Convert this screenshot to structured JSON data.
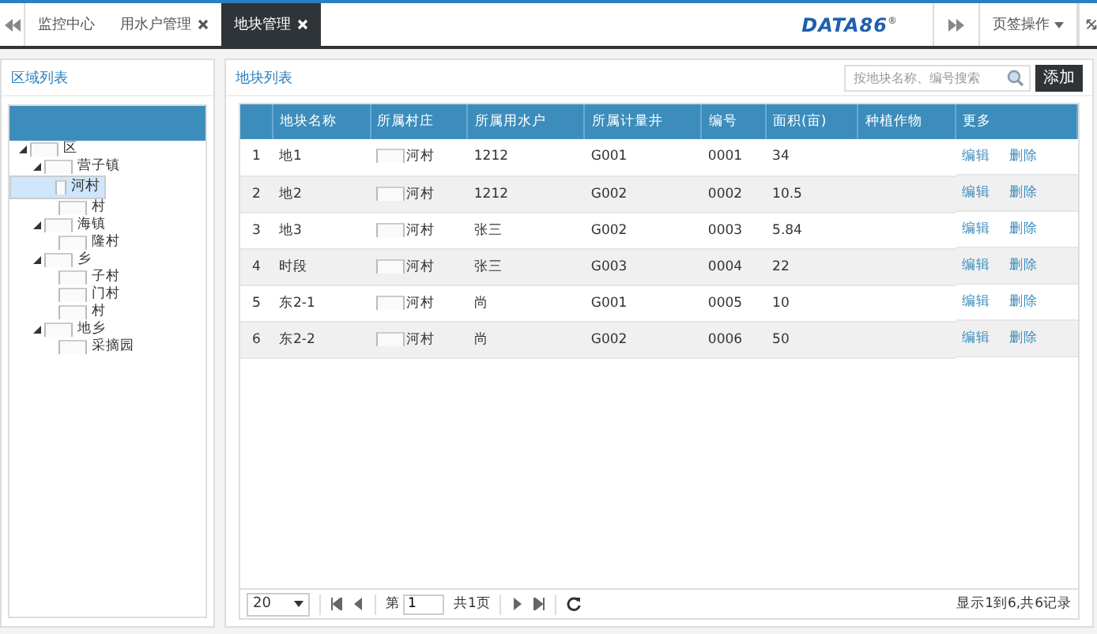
{
  "tabs": [
    {
      "label": "监控中心",
      "closable": false,
      "selected": false
    },
    {
      "label": "用水户管理",
      "closable": true,
      "selected": false
    },
    {
      "label": "地块管理",
      "closable": true,
      "selected": true
    }
  ],
  "logo": {
    "text": "DATA86",
    "mark": "®"
  },
  "tab_menu": "页签操作",
  "area_panel": {
    "title": "区域列表",
    "tree": [
      {
        "label": "区",
        "expanded": true,
        "selected": false,
        "children": [
          {
            "label": "营子镇",
            "expanded": true,
            "selected": false,
            "children": [
              {
                "label": "河村",
                "selected": true
              },
              {
                "label": "村",
                "selected": false
              }
            ]
          },
          {
            "label": "海镇",
            "expanded": true,
            "selected": false,
            "children": [
              {
                "label": "隆村",
                "selected": false
              }
            ]
          },
          {
            "label": "乡",
            "expanded": true,
            "selected": false,
            "children": [
              {
                "label": "子村",
                "selected": false
              },
              {
                "label": "门村",
                "selected": false
              },
              {
                "label": "村",
                "selected": false
              }
            ]
          },
          {
            "label": "地乡",
            "expanded": true,
            "selected": false,
            "children": [
              {
                "label": "采摘园",
                "selected": false
              }
            ]
          }
        ]
      }
    ]
  },
  "plot_panel": {
    "title": "地块列表",
    "search": {
      "placeholder": "按地块名称、编号搜索"
    },
    "add_button": "添加",
    "table": {
      "columns": [
        "地块名称",
        "所属村庄",
        "所属用水户",
        "所属计量井",
        "编号",
        "面积(亩)",
        "种植作物",
        "更多"
      ],
      "rows": [
        {
          "index": "1",
          "cells": [
            "地1",
            "河村",
            "1212",
            "G001",
            "0001",
            "34",
            ""
          ],
          "actions": [
            "编辑",
            "删除"
          ]
        },
        {
          "index": "2",
          "cells": [
            "地2",
            "河村",
            "1212",
            "G002",
            "0002",
            "10.5",
            ""
          ],
          "actions": [
            "编辑",
            "删除"
          ]
        },
        {
          "index": "3",
          "cells": [
            "地3",
            "河村",
            "张三",
            "G002",
            "0003",
            "5.84",
            ""
          ],
          "actions": [
            "编辑",
            "删除"
          ]
        },
        {
          "index": "4",
          "cells": [
            "时段",
            "河村",
            "张三",
            "G003",
            "0004",
            "22",
            ""
          ],
          "actions": [
            "编辑",
            "删除"
          ]
        },
        {
          "index": "5",
          "cells": [
            "东2-1",
            "河村",
            "尚",
            "G001",
            "0005",
            "10",
            ""
          ],
          "actions": [
            "编辑",
            "删除"
          ]
        },
        {
          "index": "6",
          "cells": [
            "东2-2",
            "河村",
            "尚",
            "G002",
            "0006",
            "50",
            ""
          ],
          "actions": [
            "编辑",
            "删除"
          ]
        }
      ]
    },
    "pager": {
      "page_size": "20",
      "page_prefix": "第",
      "page": "1",
      "page_total": "共1页",
      "summary": "显示1到6,共6记录"
    }
  }
}
